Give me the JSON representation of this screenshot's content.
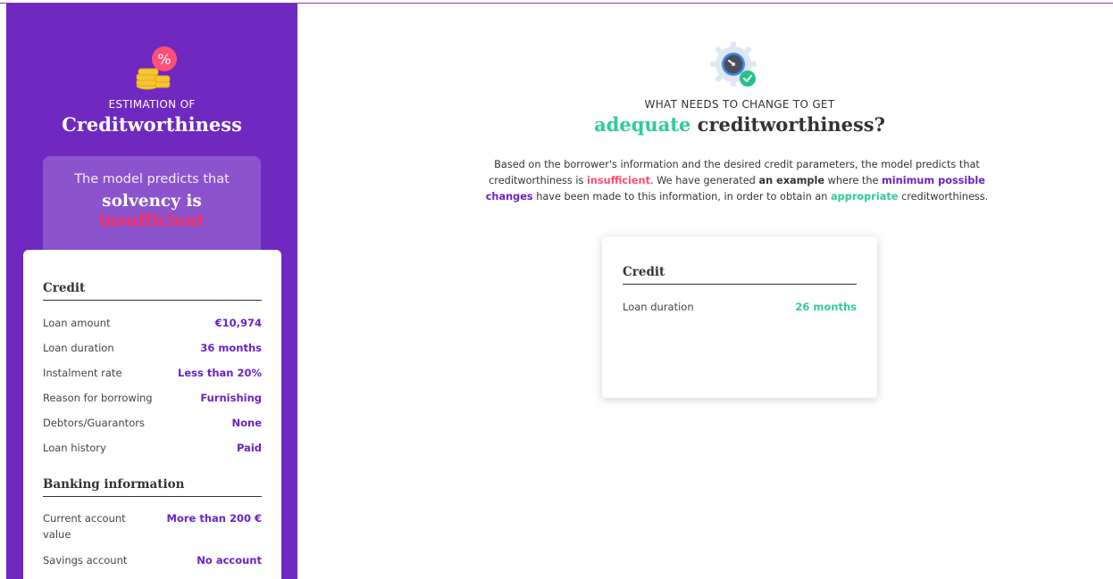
{
  "sidebar": {
    "subtitle": "ESTIMATION OF",
    "title": "Creditworthiness",
    "prediction": {
      "line1": "The model predicts that",
      "line2": "solvency is",
      "line3": "insufficient"
    },
    "sections": [
      {
        "title": "Credit",
        "rows": [
          {
            "label": "Loan amount",
            "value": "€10,974"
          },
          {
            "label": "Loan duration",
            "value": "36 months"
          },
          {
            "label": "Instalment rate",
            "value": "Less than 20%"
          },
          {
            "label": "Reason for borrowing",
            "value": "Furnishing"
          },
          {
            "label": "Debtors/Guarantors",
            "value": "None"
          },
          {
            "label": "Loan history",
            "value": "Paid"
          }
        ]
      },
      {
        "title": "Banking information",
        "rows": [
          {
            "label": "Current account value",
            "value": "More than 200 €"
          },
          {
            "label": "Savings account",
            "value": "No account"
          }
        ]
      }
    ]
  },
  "main": {
    "subtitle": "WHAT NEEDS TO CHANGE TO GET",
    "title_highlight": "adequate",
    "title_rest": "creditworthiness",
    "title_mark": "?",
    "description": {
      "p1": "Based on the borrower's information and the desired credit parameters, the model predicts that creditworthiness is",
      "insufficient": "insufficient",
      "p2": ". We have generated",
      "an_example": "an example",
      "p3": "where the",
      "minimum_changes": "minimum possible changes",
      "p4": "have been made to this information, in order to obtain an",
      "appropriate": "appropriate",
      "p5": "creditworthiness."
    },
    "result_card": {
      "title": "Credit",
      "rows": [
        {
          "label": "Loan duration",
          "value": "26 months"
        }
      ]
    }
  },
  "colors": {
    "sidebar_bg": "#6f28c0",
    "accent_purple": "#6a22c6",
    "accent_green": "#2ecc9a",
    "accent_pink": "#ff2e63"
  },
  "icons": {
    "sidebar_logo": "coins-percent-icon",
    "main_logo": "gear-gauge-check-icon"
  }
}
